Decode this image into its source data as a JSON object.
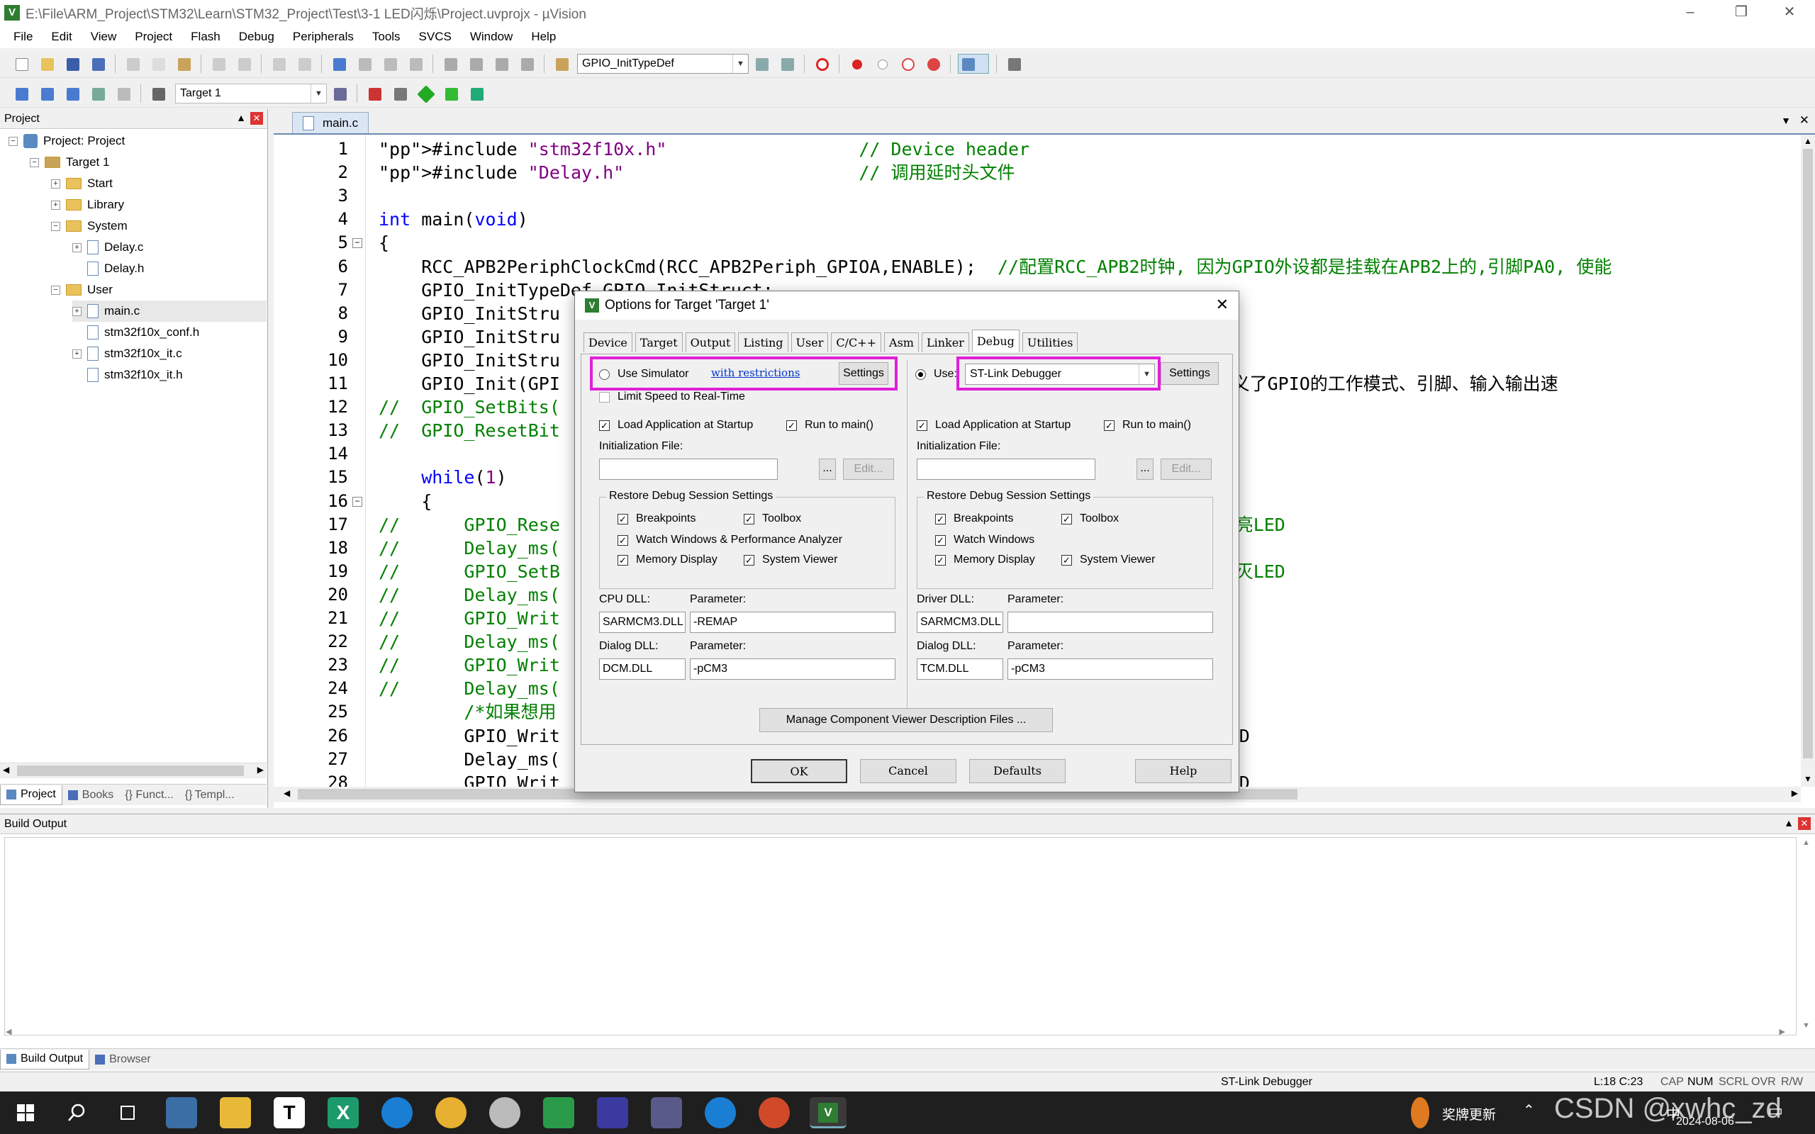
{
  "window": {
    "title": "E:\\File\\ARM_Project\\STM32\\Learn\\STM32_Project\\Test\\3-1 LED闪烁\\Project.uvprojx - µVision"
  },
  "menu": [
    "File",
    "Edit",
    "View",
    "Project",
    "Flash",
    "Debug",
    "Peripherals",
    "Tools",
    "SVCS",
    "Window",
    "Help"
  ],
  "toolbar": {
    "symbol_combo": "GPIO_InitTypeDef",
    "target_combo": "Target 1"
  },
  "project": {
    "header": "Project",
    "tree": [
      {
        "label": "Project: Project"
      },
      {
        "label": "Target 1"
      },
      {
        "label": "Start"
      },
      {
        "label": "Library"
      },
      {
        "label": "System"
      },
      {
        "label": "Delay.c"
      },
      {
        "label": "Delay.h"
      },
      {
        "label": "User"
      },
      {
        "label": "main.c"
      },
      {
        "label": "stm32f10x_conf.h"
      },
      {
        "label": "stm32f10x_it.c"
      },
      {
        "label": "stm32f10x_it.h"
      }
    ],
    "tabs": [
      "Project",
      "Books",
      "{} Funct...",
      "{} Templ..."
    ]
  },
  "editor": {
    "tab": "main.c",
    "lines": [
      {
        "n": "1",
        "t": "#include \"stm32f10x.h\"                  // Device header"
      },
      {
        "n": "2",
        "t": "#include \"Delay.h\"                      // 调用延时头文件"
      },
      {
        "n": "3",
        "t": ""
      },
      {
        "n": "4",
        "t": "int main(void)"
      },
      {
        "n": "5",
        "t": "{"
      },
      {
        "n": "6",
        "t": "    RCC_APB2PeriphClockCmd(RCC_APB2Periph_GPIOA,ENABLE);  //配置RCC_APB2时钟, 因为GPIO外设都是挂载在APB2上的,引脚PA0, 使能"
      },
      {
        "n": "7",
        "t": "    GPIO_InitTypeDef GPIO_InitStruct;"
      },
      {
        "n": "8",
        "t": "    GPIO_InitStru                                                     模式"
      },
      {
        "n": "9",
        "t": "    GPIO_InitStru"
      },
      {
        "n": "10",
        "t": "    GPIO_InitStru                                                     0MHz"
      },
      {
        "n": "11",
        "t": "    GPIO_Init(GPI                                                     一个结构体定义了GPIO的工作模式、引脚、输入输出速"
      },
      {
        "n": "12",
        "t": "//  GPIO_SetBits(                                                     高电平"
      },
      {
        "n": "13",
        "t": "//  GPIO_ResetBit                                                     低电平"
      },
      {
        "n": "14",
        "t": ""
      },
      {
        "n": "15",
        "t": "    while(1)"
      },
      {
        "n": "16",
        "t": "    {"
      },
      {
        "n": "17",
        "t": "//      GPIO_Rese                                                     为低电平, 点亮LED"
      },
      {
        "n": "18",
        "t": "//      Delay_ms("
      },
      {
        "n": "19",
        "t": "//      GPIO_SetB                                                     为高电平, 熄灭LED"
      },
      {
        "n": "20",
        "t": "//      Delay_ms("
      },
      {
        "n": "21",
        "t": "//      GPIO_Writ                                                     点亮LED"
      },
      {
        "n": "22",
        "t": "//      Delay_ms("
      },
      {
        "n": "23",
        "t": "//      GPIO_Writ                                                     熄灭LED"
      },
      {
        "n": "24",
        "t": "//      Delay_ms("
      },
      {
        "n": "25",
        "t": "        /*如果想用                                                     型*/"
      },
      {
        "n": "26",
        "t": "        GPIO_Writ                                                     电平, 点亮LED"
      },
      {
        "n": "27",
        "t": "        Delay_ms("
      },
      {
        "n": "28",
        "t": "        GPIO_Writ                                                     电平, 熄灭LED"
      }
    ]
  },
  "build": {
    "header": "Build Output",
    "tabs": [
      "Build Output",
      "Browser"
    ]
  },
  "status": {
    "debugger": "ST-Link Debugger",
    "position": "L:18 C:23",
    "flags": [
      "CAP",
      "NUM",
      "SCRL",
      "OVR",
      "R/W"
    ]
  },
  "dialog": {
    "title": "Options for Target 'Target 1'",
    "tabs": [
      "Device",
      "Target",
      "Output",
      "Listing",
      "User",
      "C/C++",
      "Asm",
      "Linker",
      "Debug",
      "Utilities"
    ],
    "active_tab": "Debug",
    "left": {
      "use_simulator": "Use Simulator",
      "restrictions_link": "with restrictions",
      "settings": "Settings",
      "limit_speed": "Limit Speed to Real-Time",
      "load_app": "Load Application at Startup",
      "run_main": "Run to main()",
      "init_file": "Initialization File:",
      "browse": "...",
      "edit": "Edit...",
      "restore_group": "Restore Debug Session Settings",
      "breakpoints": "Breakpoints",
      "toolbox": "Toolbox",
      "watch": "Watch Windows & Performance Analyzer",
      "memory": "Memory Display",
      "sysviewer": "System Viewer",
      "dll_label": "CPU DLL:",
      "param_label": "Parameter:",
      "dll": "SARMCM3.DLL",
      "param": "-REMAP",
      "dialog_dll_label": "Dialog DLL:",
      "dialog_param_label": "Parameter:",
      "dialog_dll": "DCM.DLL",
      "dialog_param": "-pCM3"
    },
    "right": {
      "use": "Use:",
      "debugger": "ST-Link Debugger",
      "settings": "Settings",
      "load_app": "Load Application at Startup",
      "run_main": "Run to main()",
      "init_file": "Initialization File:",
      "browse": "...",
      "edit": "Edit...",
      "restore_group": "Restore Debug Session Settings",
      "breakpoints": "Breakpoints",
      "toolbox": "Toolbox",
      "watch": "Watch Windows",
      "memory": "Memory Display",
      "sysviewer": "System Viewer",
      "dll_label": "Driver DLL:",
      "param_label": "Parameter:",
      "dll": "SARMCM3.DLL",
      "param": "",
      "dialog_dll_label": "Dialog DLL:",
      "dialog_param_label": "Parameter:",
      "dialog_dll": "TCM.DLL",
      "dialog_param": "-pCM3"
    },
    "manage_btn": "Manage Component Viewer Description Files ...",
    "ok": "OK",
    "cancel": "Cancel",
    "defaults": "Defaults",
    "help": "Help"
  },
  "taskbar": {
    "tray_text": "奖牌更新",
    "date": "2024-08-06",
    "watermark": "CSDN @xwhc_zd",
    "ime": "中"
  },
  "colors": {
    "highlight": "#e020d8",
    "keyword": "#0000ff",
    "comment": "#008000",
    "string": "#800080"
  }
}
